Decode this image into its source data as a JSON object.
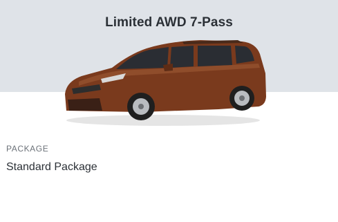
{
  "colors": {
    "hero_background": "#dfe3e8",
    "vehicle_paint": "#7a3a1d"
  },
  "trim": {
    "title": "Limited AWD 7-Pass"
  },
  "vehicle_image": {
    "icon": "minivan-image"
  },
  "package": {
    "label": "PACKAGE",
    "value": "Standard Package"
  }
}
